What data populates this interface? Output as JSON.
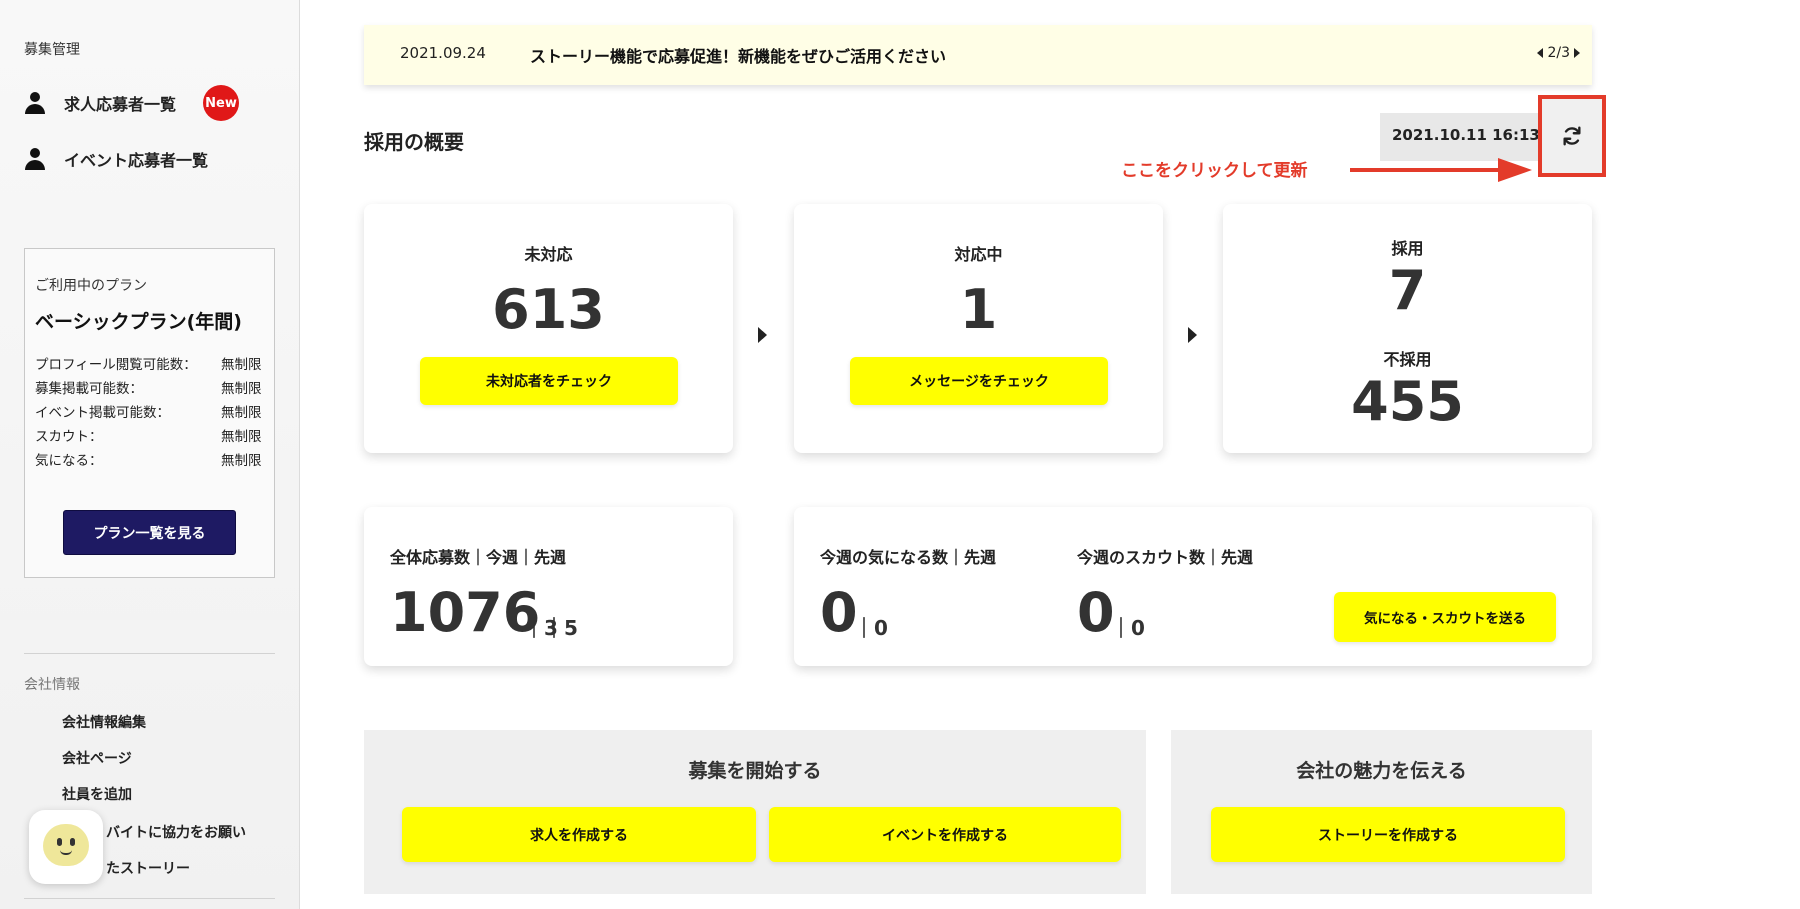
{
  "sidebar": {
    "recruit_title": "募集管理",
    "nav": [
      {
        "label": "求人応募者一覧"
      },
      {
        "label": "イベント応募者一覧"
      }
    ],
    "new_badge": "New",
    "plan": {
      "label": "ご利用中のプラン",
      "name": "ベーシックプラン(年間)",
      "rows": [
        {
          "label": "プロフィール閲覧可能数：",
          "value": "無制限"
        },
        {
          "label": "募集掲載可能数：",
          "value": "無制限"
        },
        {
          "label": "イベント掲載可能数：",
          "value": "無制限"
        },
        {
          "label": "スカウト：",
          "value": "無制限"
        },
        {
          "label": "気になる：",
          "value": "無制限"
        }
      ],
      "button": "プラン一覧を見る"
    },
    "company_title": "会社情報",
    "company_links": [
      {
        "label": "会社情報編集"
      },
      {
        "label": "会社ページ"
      },
      {
        "label": "社員を追加"
      },
      {
        "label": "バイトに協力をお願い"
      },
      {
        "label": "たストーリー"
      }
    ]
  },
  "notice": {
    "date": "2021.09.24",
    "text": "ストーリー機能で応募促進！新機能をぜひご活用ください",
    "pager": "2/3"
  },
  "overview": {
    "title": "採用の概要",
    "updated_at": "2021.10.11 16:13",
    "annotation": "ここをクリックして更新"
  },
  "status_cards": {
    "unhandled": {
      "label": "未対応",
      "value": "613",
      "button": "未対応者をチェック"
    },
    "in_progress": {
      "label": "対応中",
      "value": "1",
      "button": "メッセージをチェック"
    },
    "hired": {
      "label": "採用",
      "value": "7"
    },
    "rejected": {
      "label": "不採用",
      "value": "455"
    }
  },
  "stats": {
    "applications": {
      "label": "全体応募数｜今週｜先週",
      "total": "1076",
      "this_week": "｜3",
      "last_week": "｜5"
    },
    "interested": {
      "label": "今週の気になる数｜先週",
      "value": "0",
      "last_week": "｜0"
    },
    "scouts": {
      "label": "今週のスカウト数｜先週",
      "value": "0",
      "last_week": "｜0"
    },
    "send_button": "気になる・スカウトを送る"
  },
  "actions": {
    "recruit": {
      "title": "募集を開始する",
      "buttons": [
        "求人を作成する",
        "イベントを作成する"
      ]
    },
    "company": {
      "title": "会社の魅力を伝える",
      "buttons": [
        "ストーリーを作成する"
      ]
    }
  },
  "colors": {
    "accent_yellow": "#ffff00",
    "annotation_red": "#e33b2a",
    "plan_button": "#1e1a63",
    "badge_red": "#e01818"
  },
  "icons": [
    "person-icon",
    "refresh-icon",
    "arrow-left-icon",
    "arrow-right-icon",
    "chat-bot-icon"
  ]
}
